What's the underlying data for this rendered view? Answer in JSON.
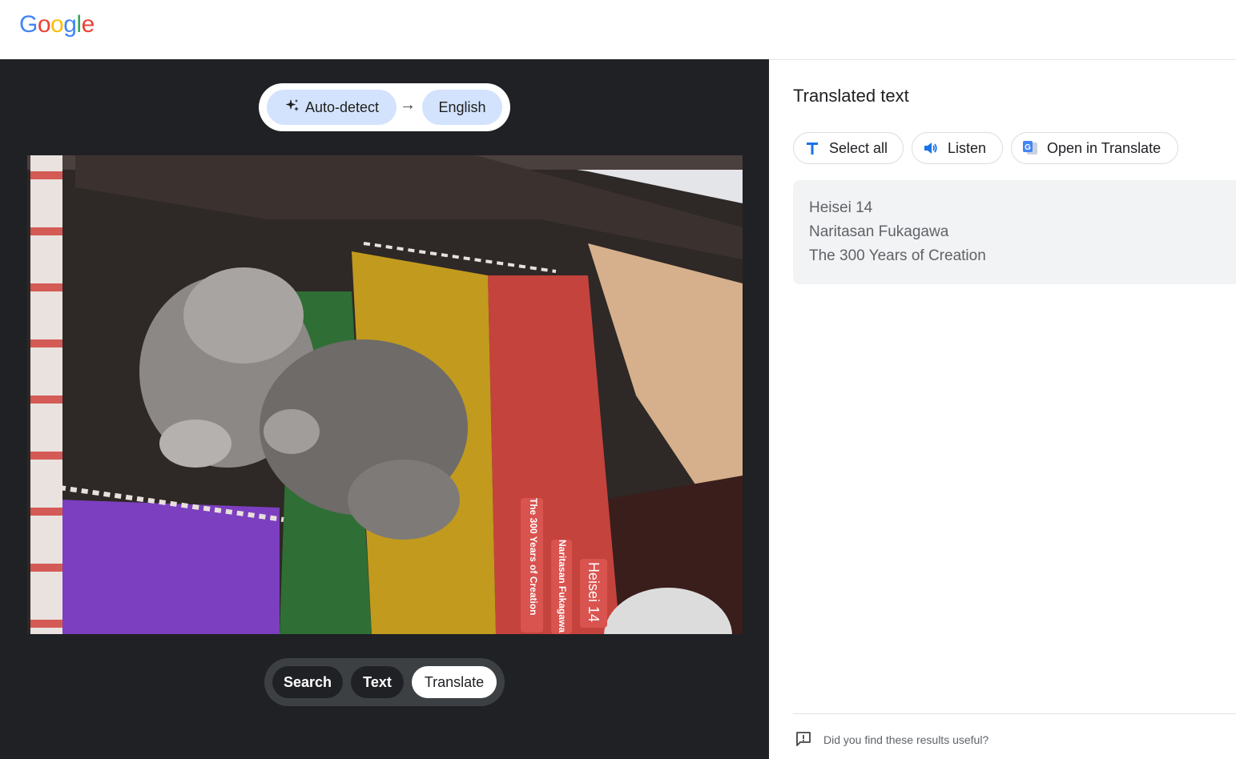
{
  "header": {
    "logo_letters": [
      "G",
      "o",
      "o",
      "g",
      "l",
      "e"
    ],
    "logo_colors": [
      "#4285F4",
      "#EA4335",
      "#FBBC05",
      "#4285F4",
      "#34A853",
      "#EA4335"
    ]
  },
  "lens": {
    "source_language": "Auto-detect",
    "target_language": "English",
    "overlays": [
      "The 300 Years of Creation",
      "Naritasan Fukagawa",
      "Heisei 14"
    ],
    "modes": [
      "Search",
      "Text",
      "Translate"
    ],
    "active_mode": "Translate"
  },
  "results": {
    "title": "Translated text",
    "actions": {
      "select_all": "Select all",
      "listen": "Listen",
      "open_in_translate": "Open in Translate"
    },
    "lines": [
      "Heisei 14",
      "Naritasan Fukagawa",
      "The 300 Years of Creation"
    ],
    "feedback": "Did you find these results useful?"
  },
  "colors": {
    "accent": "#1a73e8",
    "chip": "#d3e3fd",
    "dark_bg": "#202124"
  }
}
